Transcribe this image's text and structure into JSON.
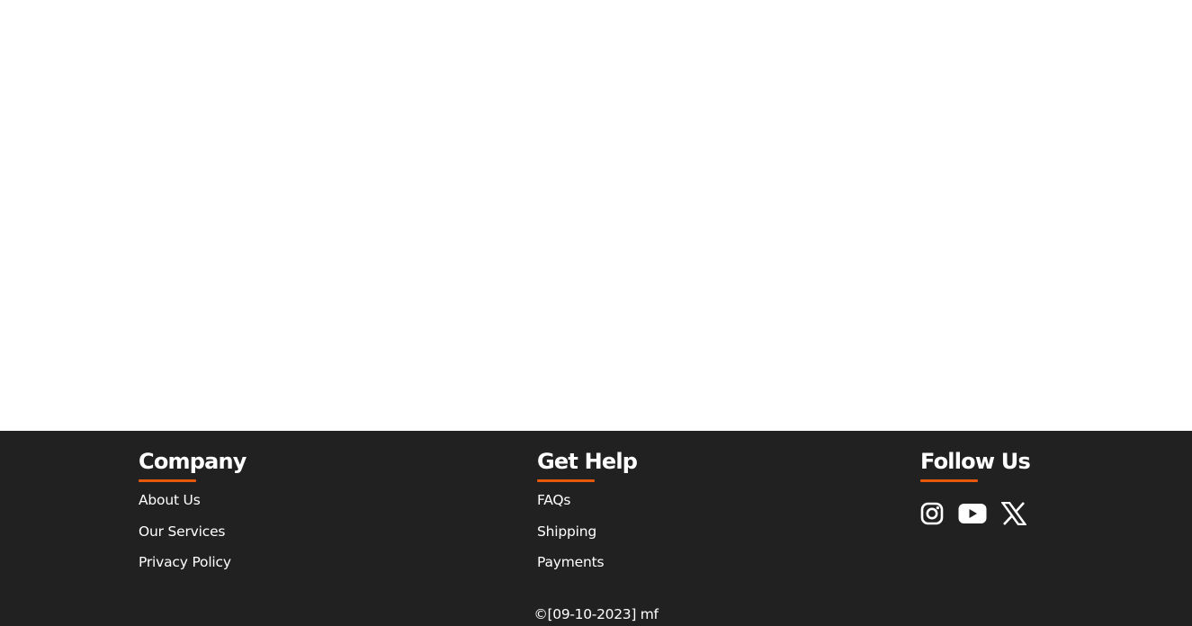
{
  "footer": {
    "company": {
      "title": "Company",
      "links": [
        "About Us",
        "Our Services",
        "Privacy Policy"
      ]
    },
    "help": {
      "title": "Get Help",
      "links": [
        "FAQs",
        "Shipping",
        "Payments"
      ]
    },
    "follow": {
      "title": "Follow Us",
      "icons": [
        "instagram-icon",
        "youtube-icon",
        "x-twitter-icon"
      ]
    },
    "copyright": "©[09-10-2023] mf"
  },
  "colors": {
    "footer_bg": "#212121",
    "accent": "#e8580c",
    "text": "#ffffff",
    "page_bg": "#ffffff"
  }
}
